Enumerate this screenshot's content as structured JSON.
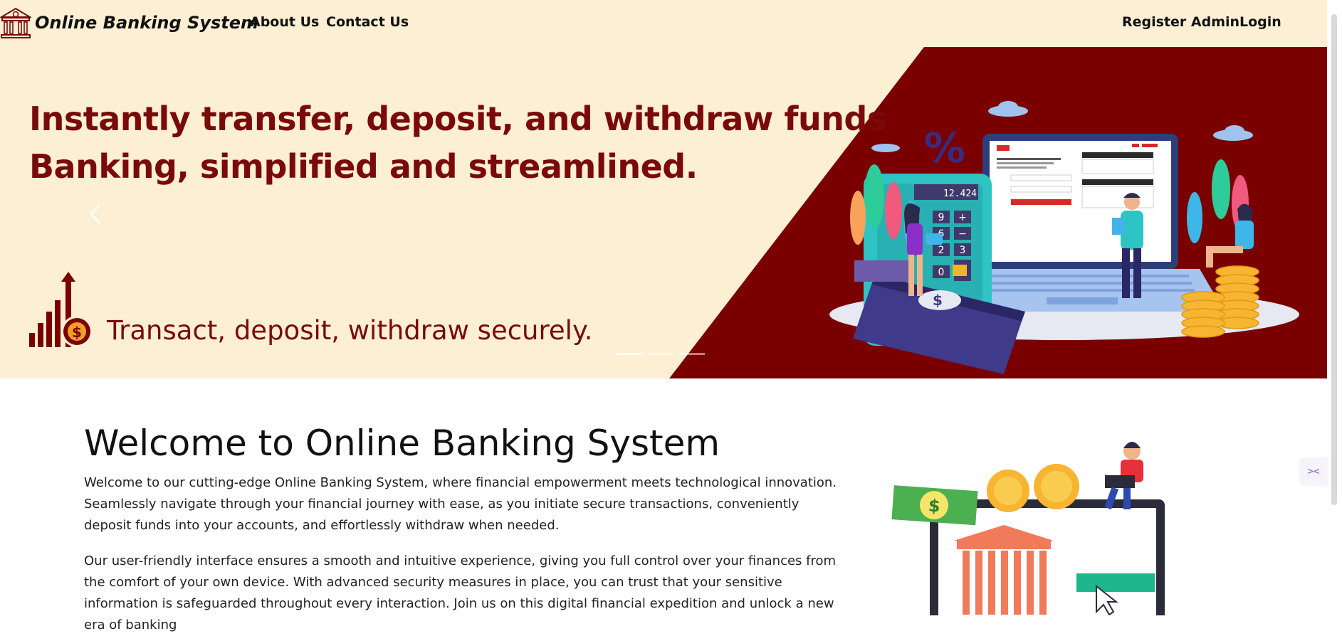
{
  "navbar": {
    "brand": "Online Banking System",
    "links": [
      "About Us",
      "Contact Us"
    ],
    "right_links": [
      "Register Admin",
      "Login"
    ]
  },
  "hero": {
    "headline_1": "Instantly transfer, deposit, and withdraw funds",
    "headline_2": "Banking, simplified and streamlined.",
    "tagline": "Transact, deposit, withdraw securely.",
    "calculator_display": "12.424",
    "percent_sign": "%",
    "dollar_sign": "$",
    "calc_keys": [
      "9",
      "+",
      "6",
      "−",
      "2",
      "3",
      "+",
      "0",
      "="
    ],
    "slides": 3,
    "active_slide": 1,
    "colors": {
      "background": "#fdefd3",
      "accent": "#7a0000"
    }
  },
  "welcome": {
    "title": "Welcome to Online Banking System",
    "para_1": "Welcome to our cutting-edge Online Banking System, where financial empowerment meets technological innovation. Seamlessly navigate through your financial journey with ease, as you initiate secure transactions, conveniently deposit funds into your accounts, and effortlessly withdraw when needed.",
    "para_2": "Our user-friendly interface ensures a smooth and intuitive experience, giving you full control over your finances from the comfort of your own device. With advanced security measures in place, you can trust that your sensitive information is safeguarded throughout every interaction. Join us on this digital financial expedition and unlock a new era of banking"
  },
  "icons": {
    "brand": "bank-building-icon",
    "prev": "chevron-left-icon",
    "side_tab": "collapse-icon"
  }
}
